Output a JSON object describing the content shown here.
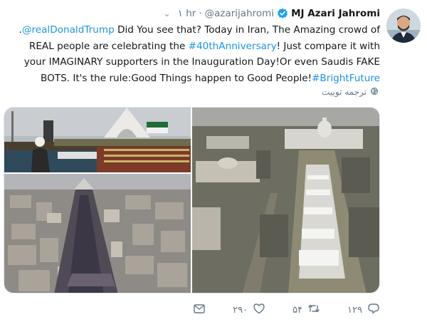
{
  "author": {
    "display_name": "MJ Azari Jahromi",
    "handle": "@azarijahromi",
    "timestamp": "۱ hr",
    "separator": "·"
  },
  "tweet": {
    "lead_dot": ".",
    "mention": "@realDonaldTrump",
    "text_1": " Did You see that? Today in Iran, The Amazing crowd of REAL people are celebrating the ",
    "hashtag_1": "#40thAnniversary",
    "text_2": "! Just compare it with your IMAGINARY supporters in the Inauguration Day!Or even Saudis FAKE BOTS. It's the rule:Good Things happen to Good People!",
    "hashtag_2": "#BrightFuture"
  },
  "translate_label": "ترجمه توییت",
  "actions": {
    "reply_count": "۱۲۹",
    "retweet_count": "۵۴",
    "like_count": "۲۹۰"
  },
  "colors": {
    "link": "#1b95e0",
    "verified": "#1da1f2",
    "muted": "#657786"
  },
  "icons": [
    "globe-icon",
    "verified-badge-icon",
    "chevron-down-icon",
    "reply-icon",
    "retweet-icon",
    "like-icon",
    "direct-message-icon"
  ]
}
